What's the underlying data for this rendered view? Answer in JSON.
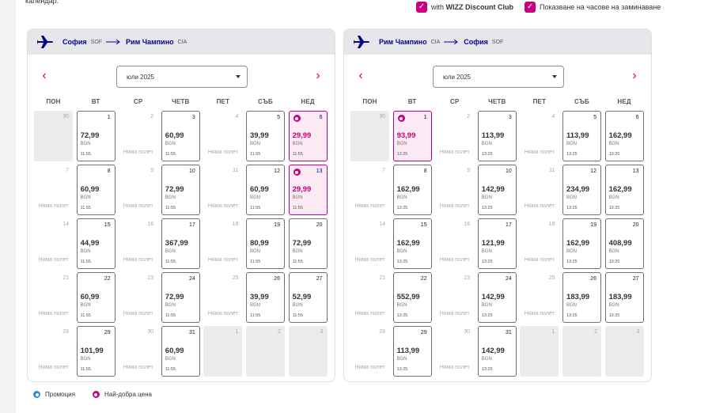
{
  "intro_text": "календар.",
  "options": [
    {
      "label_bold": "WIZZ Discount Club",
      "label_prefix": "with ",
      "checked": true
    },
    {
      "label_bold": "",
      "label_prefix": "Показване на часове на заминаване",
      "checked": true
    }
  ],
  "weekdays": [
    "ПОН",
    "ВТ",
    "СР",
    "ЧЕТВ",
    "ПЕТ",
    "СЪБ",
    "НЕД"
  ],
  "no_flight": "Няма полет",
  "calendars": [
    {
      "from_city": "София",
      "from_code": "SOF",
      "to_city": "Рим Чампино",
      "to_code": "CIA",
      "month": "юли 2025",
      "cells": [
        {
          "d": "30",
          "t": "grey"
        },
        {
          "d": "1",
          "t": "avail",
          "p": "72,99",
          "c": "BGN",
          "tm": "11:55"
        },
        {
          "d": "2",
          "t": "none"
        },
        {
          "d": "3",
          "t": "avail",
          "p": "60,99",
          "c": "BGN",
          "tm": "11:55"
        },
        {
          "d": "4",
          "t": "none"
        },
        {
          "d": "5",
          "t": "avail",
          "p": "39,99",
          "c": "BGN",
          "tm": "11:55"
        },
        {
          "d": "6",
          "t": "best",
          "p": "29,99",
          "c": "BGN",
          "tm": "11:55"
        },
        {
          "d": "7",
          "t": "none"
        },
        {
          "d": "8",
          "t": "avail",
          "p": "60,99",
          "c": "BGN",
          "tm": "11:55"
        },
        {
          "d": "9",
          "t": "none"
        },
        {
          "d": "10",
          "t": "avail",
          "p": "72,99",
          "c": "BGN",
          "tm": "11:55"
        },
        {
          "d": "11",
          "t": "none"
        },
        {
          "d": "12",
          "t": "avail",
          "p": "60,99",
          "c": "BGN",
          "tm": "11:55"
        },
        {
          "d": "13",
          "t": "best",
          "p": "29,99",
          "c": "BGN",
          "tm": "11:55"
        },
        {
          "d": "14",
          "t": "none"
        },
        {
          "d": "15",
          "t": "avail",
          "p": "44,99",
          "c": "BGN",
          "tm": "11:55"
        },
        {
          "d": "16",
          "t": "none"
        },
        {
          "d": "17",
          "t": "avail",
          "p": "367,99",
          "c": "BGN",
          "tm": "11:55"
        },
        {
          "d": "18",
          "t": "none"
        },
        {
          "d": "19",
          "t": "avail",
          "p": "80,99",
          "c": "BGN",
          "tm": "11:55"
        },
        {
          "d": "20",
          "t": "avail",
          "p": "72,99",
          "c": "BGN",
          "tm": "11:55"
        },
        {
          "d": "21",
          "t": "none"
        },
        {
          "d": "22",
          "t": "avail",
          "p": "60,99",
          "c": "BGN",
          "tm": "11:55"
        },
        {
          "d": "23",
          "t": "none"
        },
        {
          "d": "24",
          "t": "avail",
          "p": "72,99",
          "c": "BGN",
          "tm": "11:55"
        },
        {
          "d": "25",
          "t": "none"
        },
        {
          "d": "26",
          "t": "avail",
          "p": "39,99",
          "c": "BGN",
          "tm": "11:55"
        },
        {
          "d": "27",
          "t": "avail",
          "p": "52,99",
          "c": "BGN",
          "tm": "11:55"
        },
        {
          "d": "28",
          "t": "none"
        },
        {
          "d": "29",
          "t": "avail",
          "p": "101,99",
          "c": "BGN",
          "tm": "11:55"
        },
        {
          "d": "30",
          "t": "none"
        },
        {
          "d": "31",
          "t": "avail",
          "p": "60,99",
          "c": "BGN",
          "tm": "11:55"
        },
        {
          "d": "1",
          "t": "grey"
        },
        {
          "d": "2",
          "t": "grey"
        },
        {
          "d": "3",
          "t": "grey"
        }
      ]
    },
    {
      "from_city": "Рим Чампино",
      "from_code": "CIA",
      "to_city": "София",
      "to_code": "SOF",
      "month": "юли 2025",
      "cells": [
        {
          "d": "30",
          "t": "grey"
        },
        {
          "d": "1",
          "t": "best",
          "p": "93,99",
          "c": "BGN",
          "tm": "13:25"
        },
        {
          "d": "2",
          "t": "none"
        },
        {
          "d": "3",
          "t": "avail",
          "p": "113,99",
          "c": "BGN",
          "tm": "13:25"
        },
        {
          "d": "4",
          "t": "none"
        },
        {
          "d": "5",
          "t": "avail",
          "p": "113,99",
          "c": "BGN",
          "tm": "13:25"
        },
        {
          "d": "6",
          "t": "avail",
          "p": "162,99",
          "c": "BGN",
          "tm": "13:25"
        },
        {
          "d": "7",
          "t": "none"
        },
        {
          "d": "8",
          "t": "avail",
          "p": "162,99",
          "c": "BGN",
          "tm": "13:25"
        },
        {
          "d": "9",
          "t": "none"
        },
        {
          "d": "10",
          "t": "avail",
          "p": "142,99",
          "c": "BGN",
          "tm": "13:25"
        },
        {
          "d": "11",
          "t": "none"
        },
        {
          "d": "12",
          "t": "avail",
          "p": "234,99",
          "c": "BGN",
          "tm": "13:25"
        },
        {
          "d": "13",
          "t": "avail",
          "p": "162,99",
          "c": "BGN",
          "tm": "13:25"
        },
        {
          "d": "14",
          "t": "none"
        },
        {
          "d": "15",
          "t": "avail",
          "p": "162,99",
          "c": "BGN",
          "tm": "13:25"
        },
        {
          "d": "16",
          "t": "none"
        },
        {
          "d": "17",
          "t": "avail",
          "p": "121,99",
          "c": "BGN",
          "tm": "13:25"
        },
        {
          "d": "18",
          "t": "none"
        },
        {
          "d": "19",
          "t": "avail",
          "p": "162,99",
          "c": "BGN",
          "tm": "13:25"
        },
        {
          "d": "20",
          "t": "avail",
          "p": "408,99",
          "c": "BGN",
          "tm": "13:25"
        },
        {
          "d": "21",
          "t": "none"
        },
        {
          "d": "22",
          "t": "avail",
          "p": "552,99",
          "c": "BGN",
          "tm": "13:25"
        },
        {
          "d": "23",
          "t": "none"
        },
        {
          "d": "24",
          "t": "avail",
          "p": "142,99",
          "c": "BGN",
          "tm": "13:25"
        },
        {
          "d": "25",
          "t": "none"
        },
        {
          "d": "26",
          "t": "avail",
          "p": "183,99",
          "c": "BGN",
          "tm": "13:25"
        },
        {
          "d": "27",
          "t": "avail",
          "p": "183,99",
          "c": "BGN",
          "tm": "13:25"
        },
        {
          "d": "28",
          "t": "none"
        },
        {
          "d": "29",
          "t": "avail",
          "p": "113,99",
          "c": "BGN",
          "tm": "13:25"
        },
        {
          "d": "30",
          "t": "none"
        },
        {
          "d": "31",
          "t": "avail",
          "p": "142,99",
          "c": "BGN",
          "tm": "13:25"
        },
        {
          "d": "1",
          "t": "grey"
        },
        {
          "d": "2",
          "t": "grey"
        },
        {
          "d": "3",
          "t": "grey"
        }
      ]
    }
  ],
  "legend": [
    {
      "label": "Промоция",
      "icon": "promo-dot-icon"
    },
    {
      "label": "Най-добра цена",
      "icon": "best-price-dot-icon"
    }
  ],
  "colors": {
    "brand_magenta": "#c6007e",
    "brand_navy": "#06038d",
    "promo_blue": "#1d8fdb"
  }
}
